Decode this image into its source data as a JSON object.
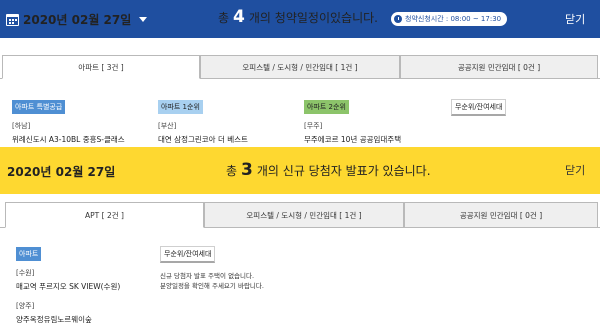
{
  "subscription": {
    "date": "2020년 02월 27일",
    "message_pre": "총",
    "count": "4",
    "message_post": "개의 청약일정이있습니다.",
    "time_badge": "청약신청시간 : 08:00 ~ 17:30",
    "close": "닫기",
    "tabs": [
      {
        "label": "아파트 [ 3건 ]"
      },
      {
        "label": "오피스텔 / 도시형 / 민간임대 [ 1건 ]"
      },
      {
        "label": "공공지원 민간임대 [ 0건 ]"
      }
    ],
    "columns": [
      {
        "badge": "아파트 특별공급",
        "region": "[하남]",
        "item": "위례신도시 A3-10BL 중흥S-클래스"
      },
      {
        "badge": "아파트 1순위",
        "region": "[부산]",
        "item": "대연 삼정그린코아 더 베스트"
      },
      {
        "badge": "아파트 2순위",
        "region": "[무주]",
        "item": "무주에코르 10년 공공임대주택"
      },
      {
        "badge": "무순위/잔여세대",
        "region": "",
        "item": ""
      }
    ]
  },
  "winners": {
    "date": "2020년 02월 27일",
    "message_pre": "총",
    "count": "3",
    "message_post": "개의 신규 당첨자 발표가 있습니다.",
    "close": "닫기",
    "tabs": [
      {
        "label": "APT [ 2건 ]"
      },
      {
        "label": "오피스텔 / 도시형 / 민간임대 [ 1건 ]"
      },
      {
        "label": "공공지원 민간임대 [ 0건 ]"
      }
    ],
    "apt": {
      "badge": "아파트",
      "items": [
        {
          "region": "[수원]",
          "name": "매교역 푸르지오 SK VIEW(수원)"
        },
        {
          "region": "[양주]",
          "name": "양주옥정유림노르웨이숲"
        }
      ]
    },
    "unranked": {
      "badge": "무순위/잔여세대",
      "line1": "신규 당첨자 발표 주택이 없습니다.",
      "line2": "분양일정을 확인해 주세요기 바랍니다."
    }
  }
}
